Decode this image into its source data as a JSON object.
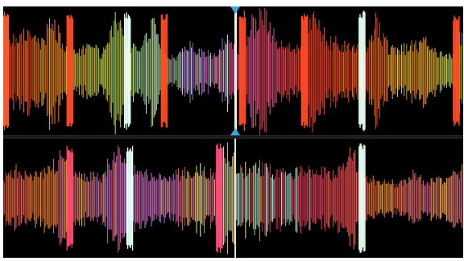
{
  "app": {
    "decks": [
      {
        "id": "deck-1",
        "waveform": {
          "seed": 17,
          "amplitude_profile": [
            0.78,
            0.55,
            0.62,
            0.48,
            0.9,
            0.35,
            0.3,
            0.45,
            0.28,
            0.95,
            0.42,
            0.38,
            0.92,
            0.3,
            0.22,
            0.5,
            0.32,
            0.28,
            0.6,
            0.3,
            0.82,
            0.95,
            0.5,
            0.45,
            0.4,
            0.9,
            0.55,
            0.48,
            0.42,
            0.35,
            0.85,
            0.4,
            0.38,
            0.45,
            0.5,
            0.3,
            0.28,
            0.75
          ],
          "colors": [
            "#ff3a2a",
            "#ff6a1f",
            "#ffae2c",
            "#d8e04a",
            "#86d06a",
            "#c6f0d0",
            "#b070d8",
            "#ff4f8a",
            "#e9442e"
          ],
          "spikes": [
            {
              "at": 0.005,
              "color": "#ff5a2a",
              "height": 0.95
            },
            {
              "at": 0.145,
              "color": "#ff4a24",
              "height": 0.92
            },
            {
              "at": 0.27,
              "color": "#e8fff0",
              "height": 0.98
            },
            {
              "at": 0.35,
              "color": "#ff4a24",
              "height": 0.95
            },
            {
              "at": 0.52,
              "color": "#ff4a24",
              "height": 0.97
            },
            {
              "at": 0.655,
              "color": "#ff4a24",
              "height": 0.94
            },
            {
              "at": 0.78,
              "color": "#e8fff0",
              "height": 0.97
            },
            {
              "at": 0.985,
              "color": "#ff4a24",
              "height": 0.9
            }
          ]
        }
      },
      {
        "id": "deck-2",
        "waveform": {
          "seed": 91,
          "amplitude_profile": [
            0.4,
            0.55,
            0.5,
            0.45,
            0.6,
            0.85,
            0.5,
            0.42,
            0.38,
            0.95,
            0.6,
            0.5,
            0.42,
            0.4,
            0.45,
            0.5,
            0.55,
            0.45,
            0.95,
            0.5,
            0.62,
            0.58,
            0.5,
            0.45,
            0.55,
            0.52,
            0.48,
            0.5,
            0.95,
            0.4,
            0.35,
            0.3,
            0.28,
            0.45,
            0.3,
            0.35,
            0.4,
            0.55
          ],
          "colors": [
            "#ff4a6a",
            "#ff6a3a",
            "#ffb040",
            "#e05aa8",
            "#c080e0",
            "#f06090",
            "#ffd060",
            "#b0f0e0",
            "#e43c52"
          ],
          "spikes": [
            {
              "at": 0.145,
              "color": "#ff4a6a",
              "height": 0.9
            },
            {
              "at": 0.275,
              "color": "#e8fff4",
              "height": 0.92
            },
            {
              "at": 0.47,
              "color": "#ff4a7a",
              "height": 0.95
            },
            {
              "at": 0.78,
              "color": "#e8fff4",
              "height": 0.95
            }
          ]
        }
      }
    ],
    "accent_color": "#3aa8d8",
    "playhead_color": "#e8f0f4"
  }
}
